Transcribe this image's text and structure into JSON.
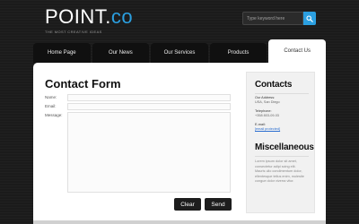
{
  "header": {
    "logo_main": "POINT.",
    "logo_accent": "co",
    "tagline": "THE MOST CREATIVE IDEAS",
    "search_placeholder": "Type keyword here"
  },
  "nav": {
    "tabs": [
      {
        "label": "Home Page"
      },
      {
        "label": "Our News"
      },
      {
        "label": "Our Services"
      },
      {
        "label": "Products"
      },
      {
        "label": "Contact Us",
        "active": true
      }
    ]
  },
  "form": {
    "title": "Contact Form",
    "name_label": "Name:",
    "email_label": "Email:",
    "message_label": "Message:",
    "clear_label": "Clear",
    "send_label": "Send"
  },
  "sidebar": {
    "contacts_title": "Contacts",
    "address_label": "Our Address:",
    "address_value": "USA, San Diego",
    "phone_label": "Telephone:",
    "phone_value": "+358 803-09-03",
    "email_label": "E-mail:",
    "email_value": "[email protected]",
    "misc_title": "Miscellaneous",
    "misc_text": "Lorem ipsum dolor sit amet, consectetur adipi scing elit. Mauris ullo condimentum dolor, ellentesque tellus enim, molestie congue dolor viverra vitor."
  },
  "colors": {
    "accent": "#2b9fe0",
    "background": "#1b1b1b",
    "button": "#1d1d1d"
  }
}
